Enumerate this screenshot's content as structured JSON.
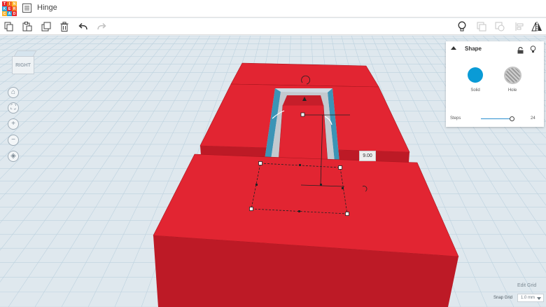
{
  "app": {
    "logo_letters": [
      "T",
      "I",
      "N",
      "K",
      "E",
      "R",
      "C",
      "A",
      "D"
    ],
    "logo_colors": [
      "#e6292f",
      "#f36d21",
      "#fbb32b",
      "#2ea3d8",
      "#e6292f",
      "#f36d21",
      "#fbb32b",
      "#2ea3d8",
      "#e6292f"
    ],
    "document_title": "Hinge"
  },
  "toolbar": {
    "icons": [
      "copy-icon",
      "paste-icon",
      "duplicate-icon",
      "delete-icon",
      "undo-icon",
      "redo-icon",
      "light-bulb-icon",
      "group-icon",
      "ungroup-icon",
      "align-icon",
      "mirror-icon"
    ]
  },
  "viewcube": {
    "face_label": "RIGHT"
  },
  "nav_buttons": [
    "home-icon",
    "fit-view-icon",
    "zoom-in-icon",
    "zoom-out-icon",
    "perspective-icon"
  ],
  "shape_panel": {
    "title": "Shape",
    "solid_label": "Solid",
    "hole_label": "Hole",
    "solid_color": "#0a9bd6",
    "steps_label": "Steps",
    "steps_value": "24",
    "steps_fraction": 0.92
  },
  "dimension": {
    "value": "9.00"
  },
  "grid": {
    "edit_label": "Edit Grid",
    "snap_label": "Snap Grid",
    "snap_value": "1.0 mm"
  },
  "colors": {
    "shape_red": "#e22532",
    "shape_red_dark": "#bd1a26",
    "hole_teal": "#3c94b6"
  }
}
